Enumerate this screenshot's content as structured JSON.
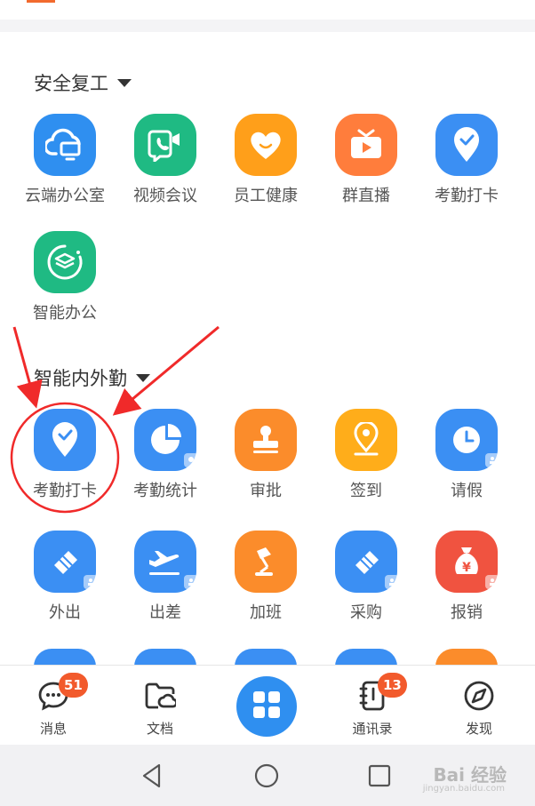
{
  "sections": [
    {
      "title": "安全复工",
      "apps": [
        {
          "label": "云端办公室",
          "icon": "cloud-office-icon",
          "color": "#2f8ff0"
        },
        {
          "label": "视频会议",
          "icon": "video-call-icon",
          "color": "#1fba83"
        },
        {
          "label": "员工健康",
          "icon": "heart-icon",
          "color": "#ff9f1a"
        },
        {
          "label": "群直播",
          "icon": "tv-live-icon",
          "color": "#ff7d3c"
        },
        {
          "label": "考勤打卡",
          "icon": "location-check-icon",
          "color": "#3b8ff3"
        },
        {
          "label": "智能办公",
          "icon": "layers-icon",
          "color": "#1fba83"
        }
      ]
    },
    {
      "title": "智能内外勤",
      "apps": [
        {
          "label": "考勤打卡",
          "icon": "location-check-icon",
          "color": "#3b8ff3"
        },
        {
          "label": "考勤统计",
          "icon": "pie-chart-icon",
          "color": "#3b8ff3"
        },
        {
          "label": "审批",
          "icon": "stamp-icon",
          "color": "#fb8c2b"
        },
        {
          "label": "签到",
          "icon": "location-pin-icon",
          "color": "#ffad1a"
        },
        {
          "label": "请假",
          "icon": "clock-icon",
          "color": "#3b8ff3"
        },
        {
          "label": "外出",
          "icon": "eraser-icon",
          "color": "#3b8ff3"
        },
        {
          "label": "出差",
          "icon": "airplane-icon",
          "color": "#3b8ff3"
        },
        {
          "label": "加班",
          "icon": "desk-lamp-icon",
          "color": "#fb8c2b"
        },
        {
          "label": "采购",
          "icon": "eraser-icon",
          "color": "#3b8ff3"
        },
        {
          "label": "报销",
          "icon": "money-bag-icon",
          "color": "#f05340"
        }
      ]
    }
  ],
  "bottom_nav": [
    {
      "label": "消息",
      "icon": "chat-bubble-icon",
      "badge": "51"
    },
    {
      "label": "文档",
      "icon": "folder-cloud-icon"
    },
    {
      "label": "",
      "icon": "grid-apps-icon"
    },
    {
      "label": "通讯录",
      "icon": "contacts-book-icon",
      "badge": "13"
    },
    {
      "label": "发现",
      "icon": "compass-icon"
    }
  ],
  "system_nav": [
    "back-icon",
    "home-icon",
    "recents-icon"
  ],
  "watermark": {
    "main": "Bai 经验",
    "sub": "jingyan.baidu.com"
  },
  "accent_color": "#f02a2a"
}
